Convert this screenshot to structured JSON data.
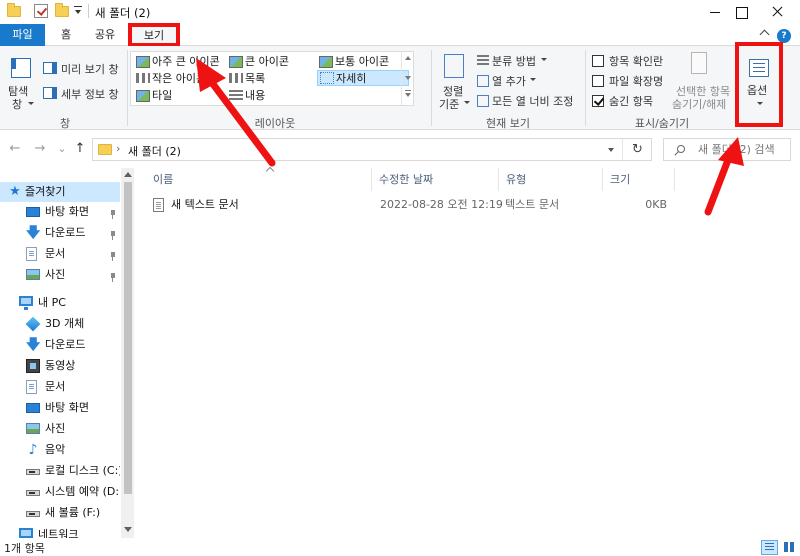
{
  "window": {
    "title": "새 폴더 (2)"
  },
  "tabs": {
    "file": "파일",
    "home": "홈",
    "share": "공유",
    "view": "보기",
    "help_glyph": "?"
  },
  "ribbon": {
    "panes": {
      "navigation_pane": [
        "탐색",
        "창"
      ],
      "preview_pane": "미리 보기 창",
      "details_pane": "세부 정보 창",
      "group_label": "창"
    },
    "layout": {
      "items": {
        "extra_large_icons": "아주 큰 아이콘",
        "large_icons": "큰 아이콘",
        "medium_icons": "보통 아이콘",
        "small_icons": "작은 아이콘",
        "list": "목록",
        "details": "자세히",
        "tiles": "타일",
        "content": "내용"
      },
      "group_label": "레이아웃"
    },
    "current_view": {
      "sort_by": [
        "정렬",
        "기준"
      ],
      "group_by": "분류 방법",
      "add_columns": "열 추가",
      "size_all_columns": "모든 열 너비 조정",
      "group_label": "현재 보기"
    },
    "show_hide": {
      "item_check_boxes": "항목 확인란",
      "item_check_boxes_checked": false,
      "file_name_extensions": "파일 확장명",
      "file_name_extensions_checked": false,
      "hidden_items": "숨긴 항목",
      "hidden_items_checked": true,
      "hide_selected": [
        "선택한 항목",
        "숨기기/해제"
      ],
      "group_label": "표시/숨기기"
    },
    "options": {
      "label": "옵션"
    }
  },
  "navigation": {
    "back_glyph": "←",
    "forward_glyph": "→",
    "recent_glyph": "⌄",
    "up_glyph": "↑",
    "path_separator": "›",
    "address": "새 폴더 (2)",
    "refresh_glyph": "↻",
    "search_placeholder": "새 폴더 (2) 검색"
  },
  "sidebar": {
    "quick_access": {
      "label": "즐겨찾기",
      "items": [
        "바탕 화면",
        "다운로드",
        "문서",
        "사진"
      ]
    },
    "this_pc": {
      "label": "내 PC",
      "items": [
        "3D 개체",
        "다운로드",
        "동영상",
        "문서",
        "바탕 화면",
        "사진",
        "음악",
        "로컬 디스크 (C:)",
        "시스템 예약 (D:)",
        "새 볼륨 (F:)"
      ]
    },
    "network": {
      "label": "네트워크"
    }
  },
  "filelist": {
    "columns": {
      "name": "이름",
      "date_modified": "수정한 날짜",
      "type": "유형",
      "size": "크기"
    },
    "rows": [
      {
        "name": "새 텍스트 문서",
        "date_modified": "2022-08-28 오전 12:19",
        "type": "텍스트 문서",
        "size": "0KB"
      }
    ]
  },
  "statusbar": {
    "item_count": "1개 항목"
  },
  "colors": {
    "accent": "#1979ca",
    "annotation": "#ee1212",
    "selection": "#cce8ff"
  }
}
